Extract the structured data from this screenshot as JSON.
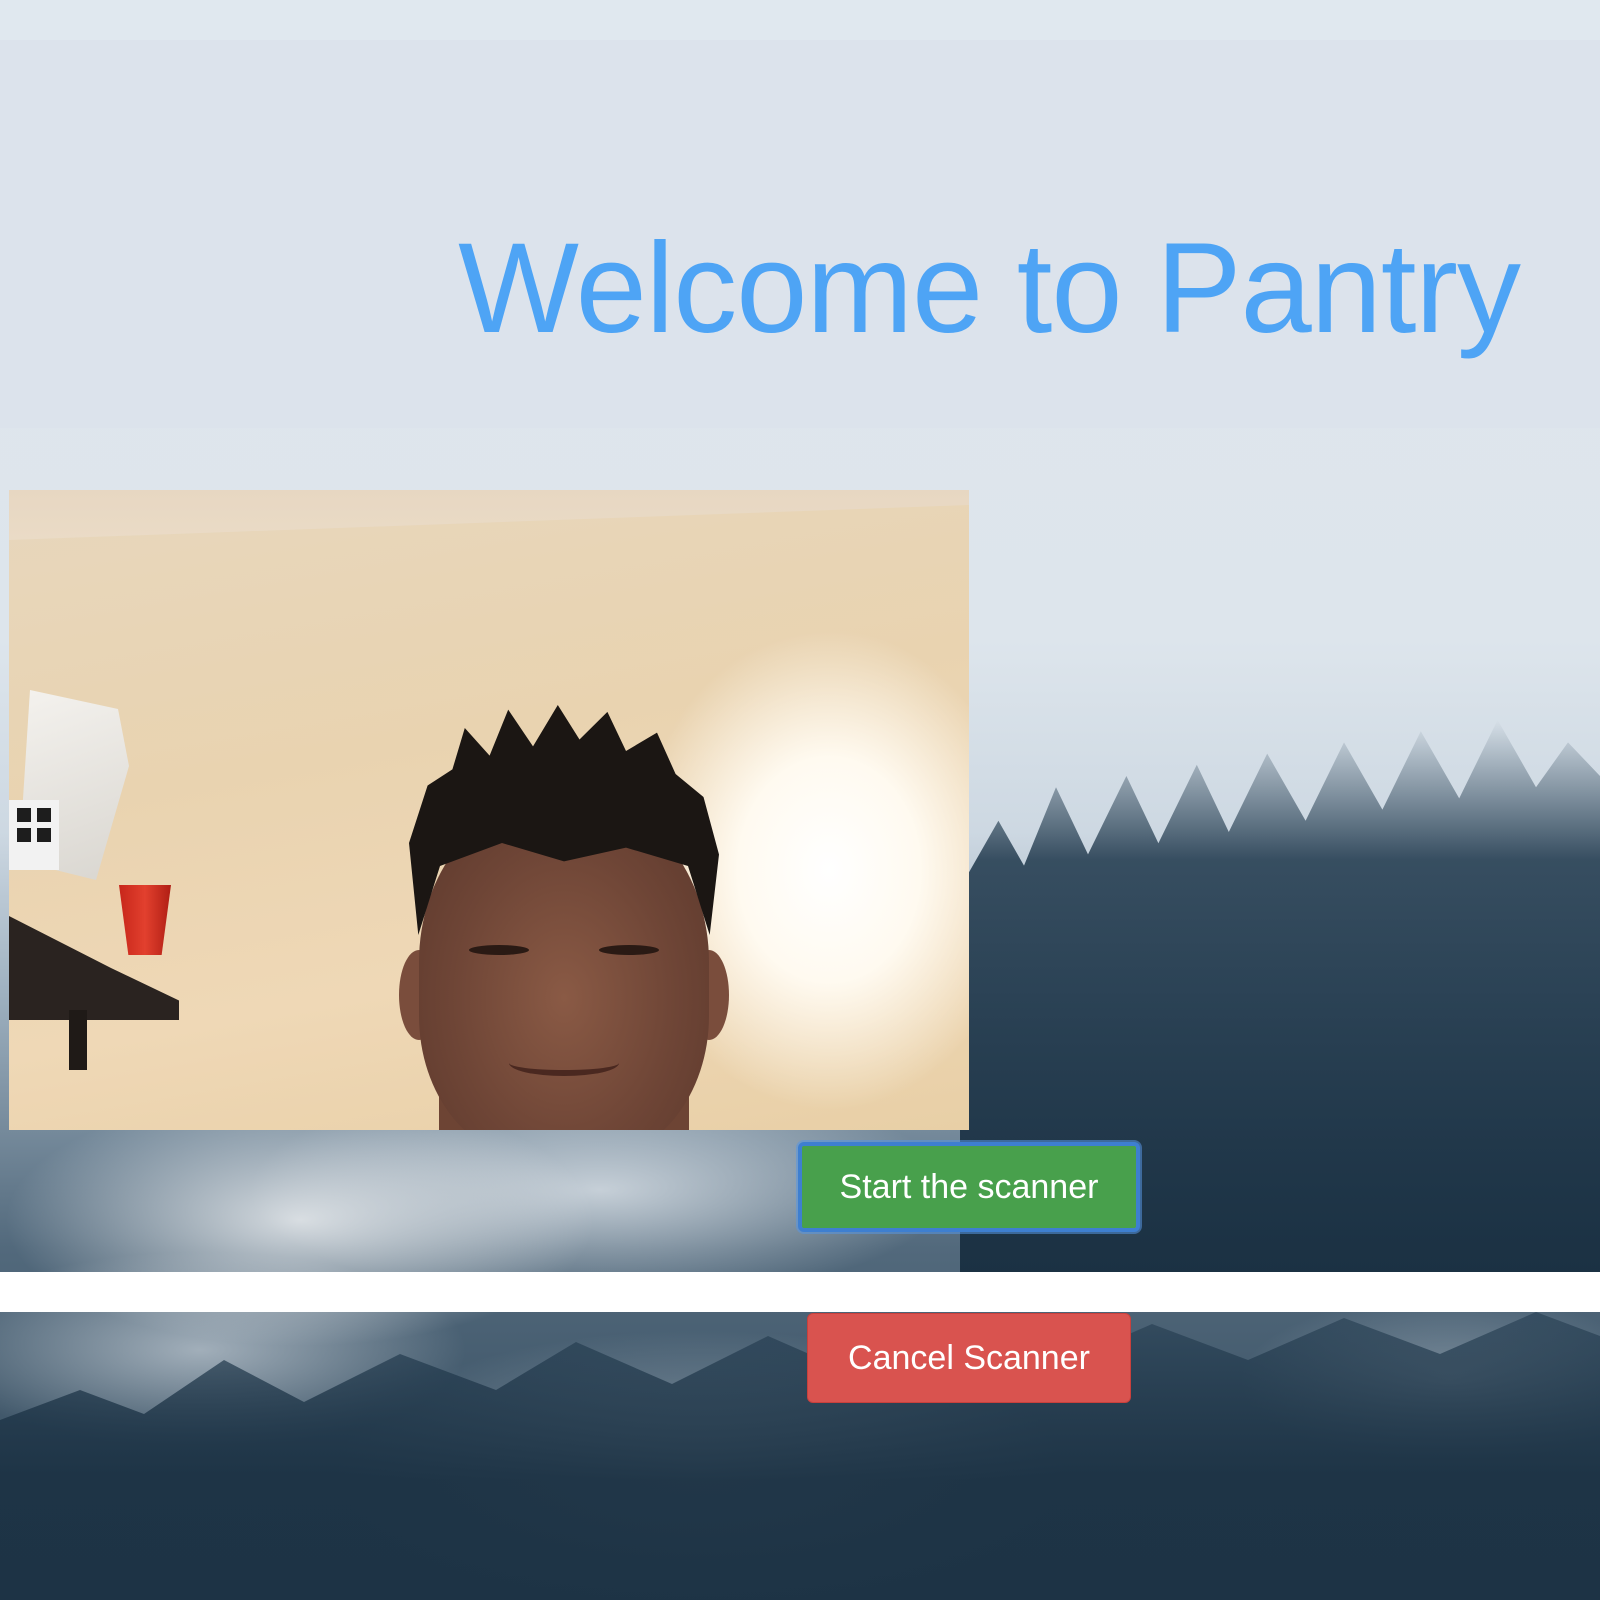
{
  "header": {
    "title": "Welcome to Pantry"
  },
  "camera": {
    "label": "webcam-feed"
  },
  "buttons": {
    "start_label": "Start the scanner",
    "cancel_label": "Cancel Scanner"
  },
  "colors": {
    "title": "#4ea4f5",
    "start_button": "#48a04c",
    "start_button_focus_ring": "#3e7fd0",
    "cancel_button": "#d9534f",
    "header_background": "#dce3ec"
  }
}
